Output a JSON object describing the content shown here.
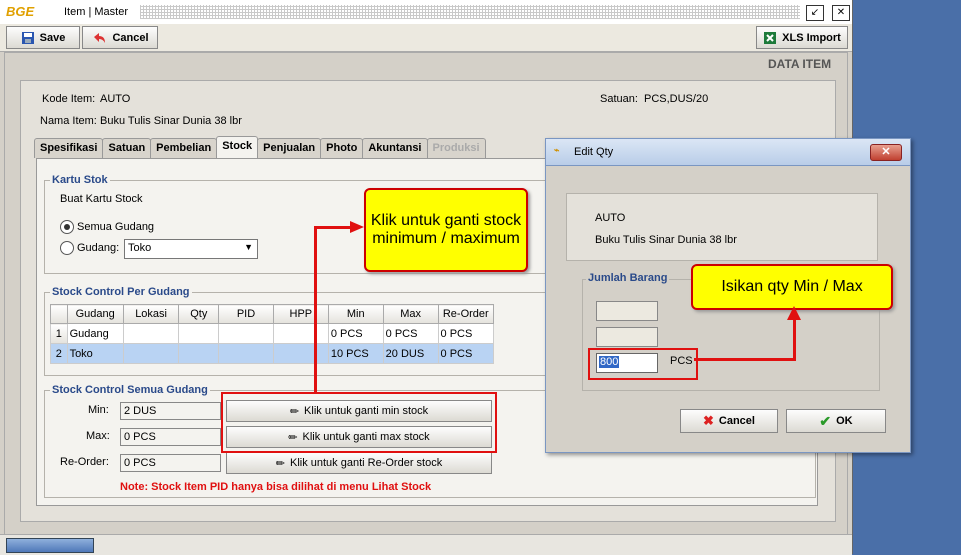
{
  "window": {
    "logo": "BGE",
    "title": "Item | Master",
    "min_icon": "↙",
    "close_icon": "✕"
  },
  "toolbar": {
    "save": "Save",
    "cancel": "Cancel",
    "xls_import": "XLS Import"
  },
  "header": {
    "section_title": "DATA ITEM"
  },
  "item": {
    "kode_label": "Kode Item:",
    "kode_value": "AUTO",
    "nama_label": "Nama Item:",
    "nama_value": "Buku Tulis Sinar Dunia 38 lbr",
    "satuan_label": "Satuan:",
    "satuan_value": "PCS,DUS/20"
  },
  "tabs": [
    {
      "label": "Spesifikasi"
    },
    {
      "label": "Satuan"
    },
    {
      "label": "Pembelian"
    },
    {
      "label": "Stock"
    },
    {
      "label": "Penjualan"
    },
    {
      "label": "Photo"
    },
    {
      "label": "Akuntansi"
    },
    {
      "label": "Produksi"
    }
  ],
  "kartu_stok": {
    "title": "Kartu Stok",
    "buat": "Buat Kartu Stock",
    "semua_gudang": "Semua Gudang",
    "gudang_label": "Gudang:",
    "gudang_value": "Toko"
  },
  "stock_control_gudang": {
    "title": "Stock Control Per Gudang",
    "columns": [
      "Gudang",
      "Lokasi",
      "Qty",
      "PID",
      "HPP",
      "Min",
      "Max",
      "Re-Order"
    ],
    "rows": [
      {
        "no": "1",
        "gudang": "Gudang",
        "lokasi": "",
        "qty": "",
        "pid": "",
        "hpp": "",
        "min": "0 PCS",
        "max": "0 PCS",
        "reorder": "0 PCS"
      },
      {
        "no": "2",
        "gudang": "Toko",
        "lokasi": "",
        "qty": "",
        "pid": "",
        "hpp": "",
        "min": "10 PCS",
        "max": "20 DUS",
        "reorder": "0 PCS"
      }
    ]
  },
  "stock_control_semua": {
    "title": "Stock Control Semua Gudang",
    "min_label": "Min:",
    "min_value": "2 DUS",
    "max_label": "Max:",
    "max_value": "0 PCS",
    "reorder_label": "Re-Order:",
    "reorder_value": "0 PCS",
    "btn_min": "Klik untuk ganti min stock",
    "btn_max": "Klik untuk ganti max stock",
    "btn_reorder": "Klik untuk ganti Re-Order stock",
    "note": "Note: Stock Item PID hanya bisa dilihat di menu Lihat Stock"
  },
  "callouts": {
    "left": "Klik untuk ganti stock minimum / maximum",
    "right": "Isikan qty Min / Max"
  },
  "dialog": {
    "title": "Edit Qty",
    "kode": "AUTO",
    "nama": "Buku Tulis Sinar Dunia 38 lbr",
    "jumlah_title": "Jumlah Barang",
    "qty_value": "800",
    "qty_unit": "PCS",
    "cancel": "Cancel",
    "ok": "OK"
  },
  "colors": {
    "accent_red": "#e01010",
    "callout_yellow": "#ffff00",
    "group_title": "#2a4a8a"
  }
}
